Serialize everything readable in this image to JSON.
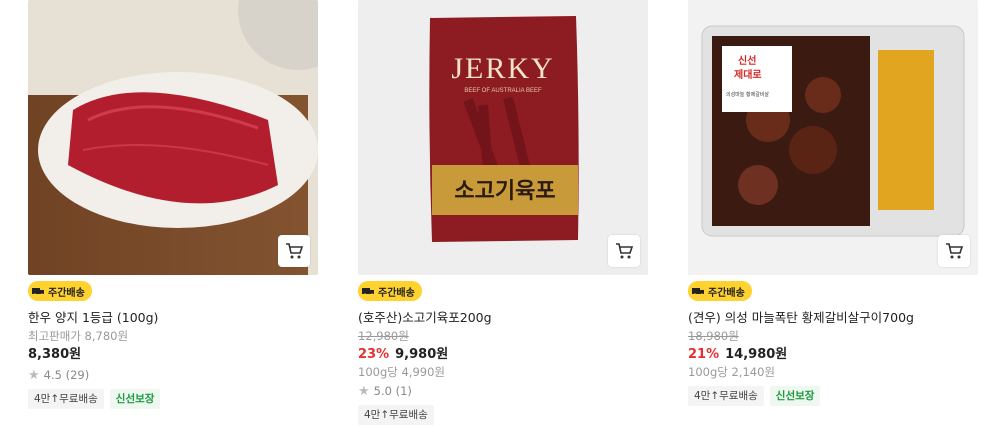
{
  "products": [
    {
      "badge": "주간배송",
      "name": "한우 양지 1등급 (100g)",
      "orig_price": "최고판매가 8,780원",
      "discount": "",
      "price": "8,380원",
      "unit_price": "",
      "rating": "4.5",
      "reviews": "(29)",
      "tags": [
        "4만↑무료배송",
        "신선보장"
      ],
      "image_icon": "sliced-beef-image"
    },
    {
      "badge": "주간배송",
      "name": "(호주산)소고기육포200g",
      "orig_price": "12,980원",
      "discount": "23%",
      "price": "9,980원",
      "unit_price": "100g당 4,990원",
      "rating": "5.0",
      "reviews": "(1)",
      "tags": [
        "4만↑무료배송"
      ],
      "package_brand": "JERKY",
      "package_sub": "BEEF OF AUSTRALIA BEEF",
      "package_label": "소고기육포",
      "image_icon": "jerky-package-image"
    },
    {
      "badge": "주간배송",
      "name": "(견우) 의성 마늘폭탄 황제갈비살구이700g",
      "orig_price": "18,980원",
      "discount": "21%",
      "price": "14,980원",
      "unit_price": "100g당 2,140원",
      "rating": "",
      "reviews": "",
      "tags": [
        "4만↑무료배송",
        "신선보장"
      ],
      "sticker_line1": "신선",
      "sticker_line2": "제대로",
      "sticker_text": "의성마늘 황제갈비살",
      "image_icon": "marinated-ribs-tray-image"
    }
  ],
  "colors": {
    "badge_yellow": "#ffd230",
    "discount_red": "#e83030",
    "fresh_green": "#1a9a3d"
  },
  "cart_icon": "cart-icon"
}
